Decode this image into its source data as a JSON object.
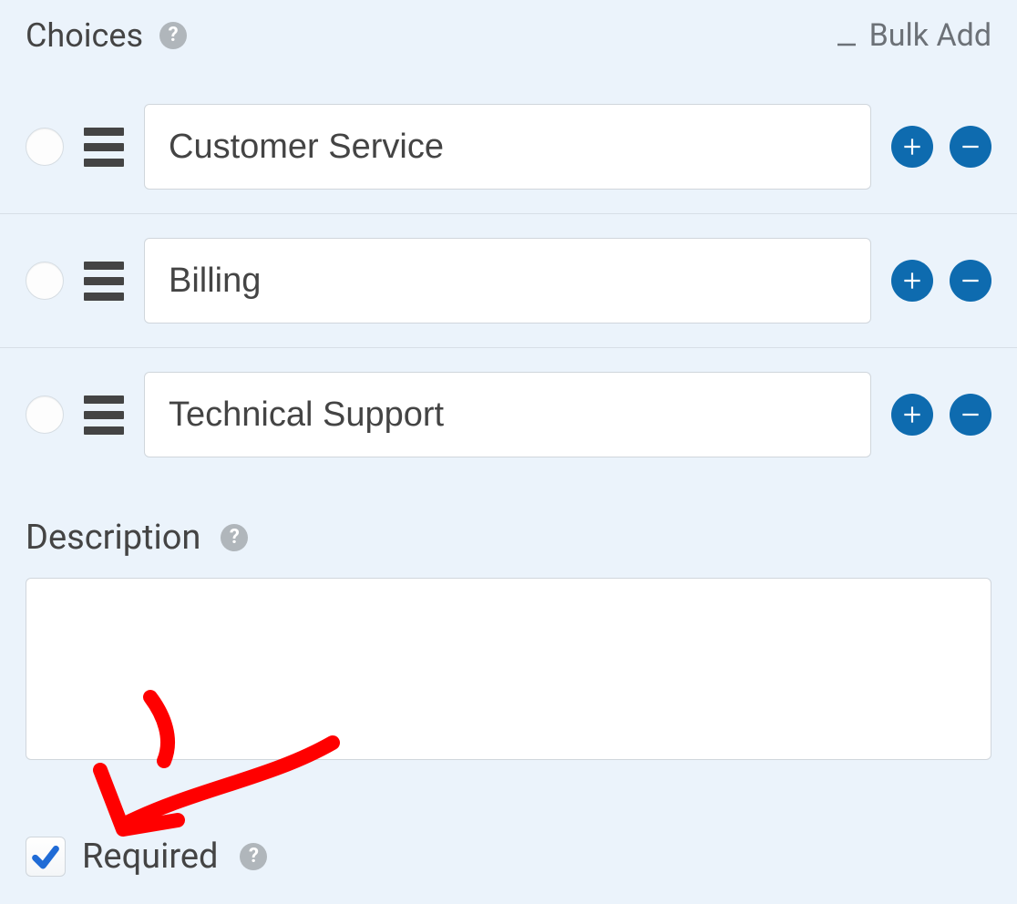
{
  "header": {
    "choices_label": "Choices",
    "bulk_add_label": "Bulk Add"
  },
  "choices": [
    {
      "value": "Customer Service"
    },
    {
      "value": "Billing"
    },
    {
      "value": "Technical Support"
    }
  ],
  "description": {
    "label": "Description",
    "value": ""
  },
  "required": {
    "label": "Required",
    "checked": true
  },
  "colors": {
    "accent": "#0e6baf",
    "panel_bg": "#ebf3fb",
    "check_blue": "#1f6bd6",
    "annotation_red": "#ff0000"
  },
  "icons": {
    "help": "question-circle-icon",
    "download": "download-icon",
    "drag": "drag-handle-icon",
    "plus": "plus-circle-icon",
    "minus": "minus-circle-icon",
    "check": "check-icon"
  }
}
